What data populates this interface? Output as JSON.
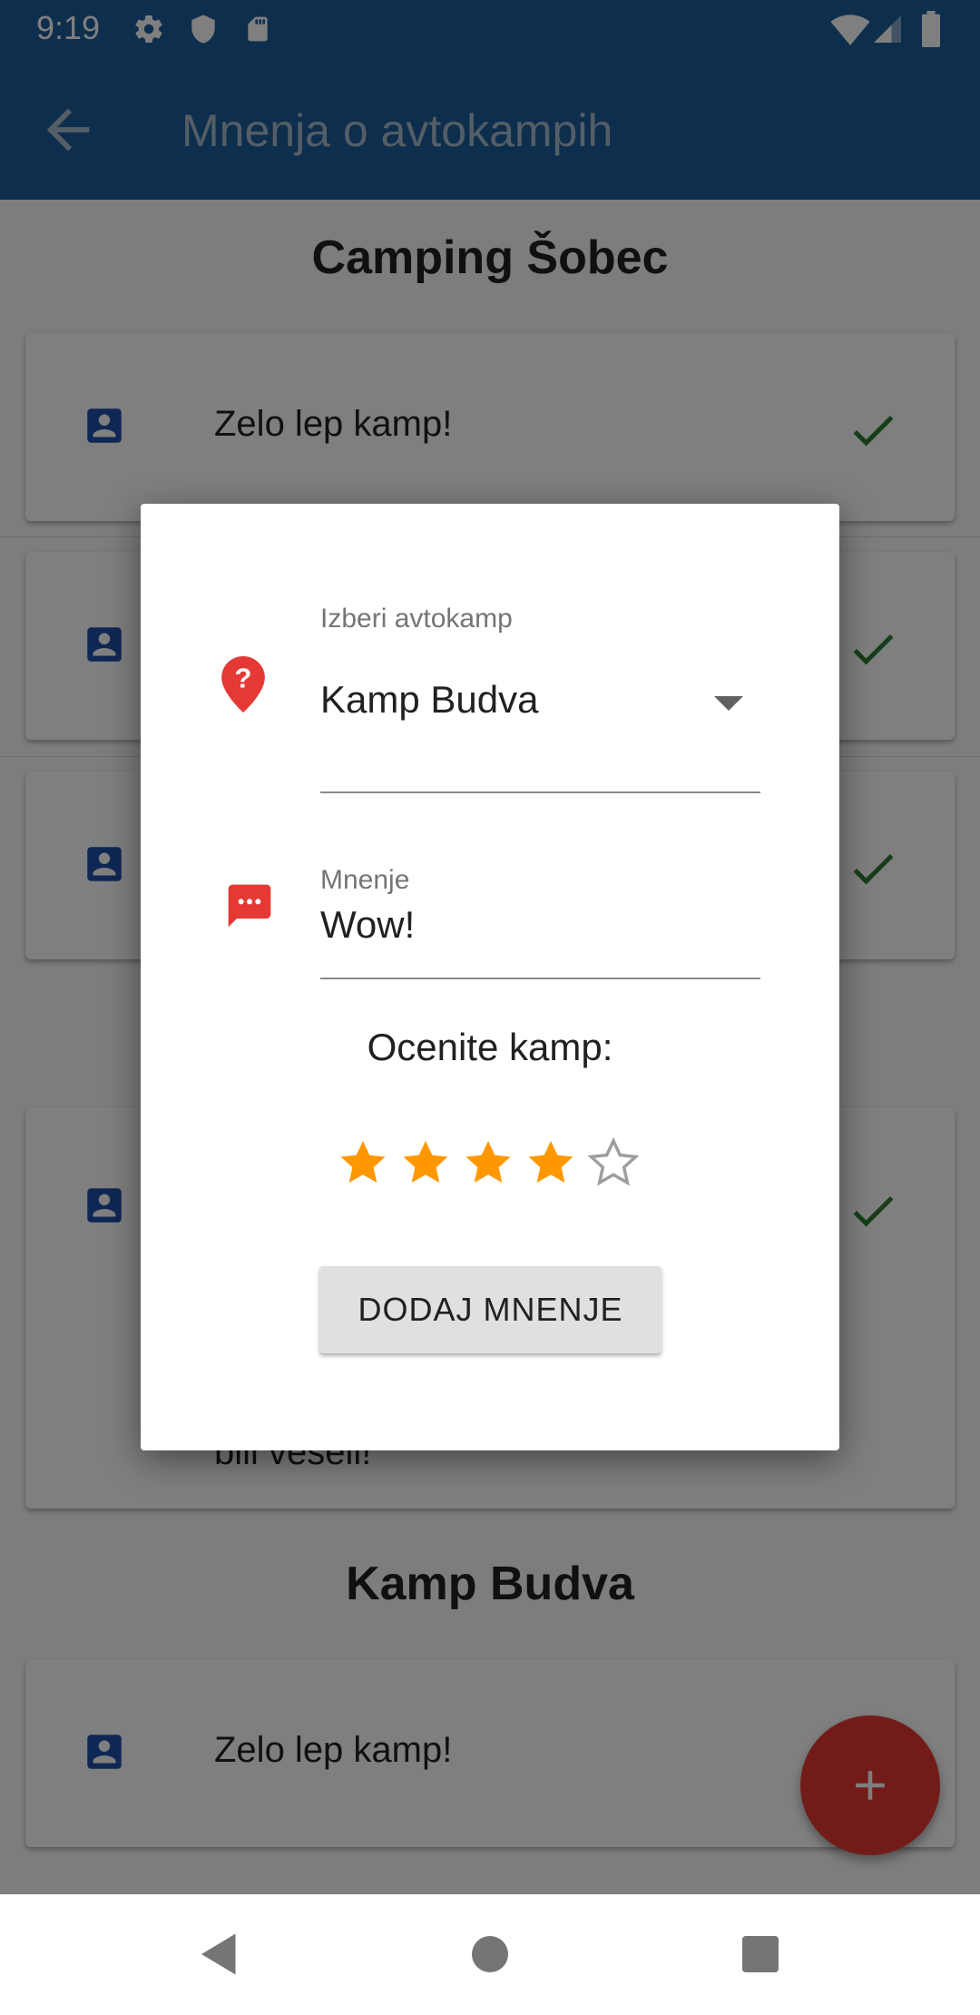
{
  "status_bar": {
    "time": "9:19"
  },
  "app_bar": {
    "title": "Mnenja o avtokampih"
  },
  "sections": [
    {
      "title": "Camping Šobec",
      "reviews": [
        {
          "text": "Zelo lep kamp!"
        },
        {
          "text": ""
        },
        {
          "text": ""
        },
        {
          "text": "bili veseli!"
        }
      ]
    },
    {
      "title": "Kamp Budva",
      "reviews": [
        {
          "text": "Zelo lep kamp!"
        }
      ]
    }
  ],
  "dialog": {
    "camp_field": {
      "label": "Izberi avtokamp",
      "value": "Kamp Budva"
    },
    "review_field": {
      "label": "Mnenje",
      "value": "Wow!"
    },
    "rating": {
      "label": "Ocenite kamp:",
      "value": 4,
      "max": 5
    },
    "submit_label": "DODAJ MNENJE"
  },
  "colors": {
    "primary": "#1c5d9a",
    "accent": "#e53935",
    "star": "#ff9800",
    "check": "#2e7d32",
    "contact_icon": "#1e4fa8"
  },
  "icons": {
    "settings": "gear-icon",
    "shield": "shield-icon",
    "sd_card": "sd-card-icon",
    "wifi": "wifi-icon",
    "signal": "signal-icon",
    "battery": "battery-icon",
    "back": "arrow-back-icon",
    "camp_picker": "place-help-icon",
    "review": "message-icon",
    "fab": "add-icon"
  }
}
